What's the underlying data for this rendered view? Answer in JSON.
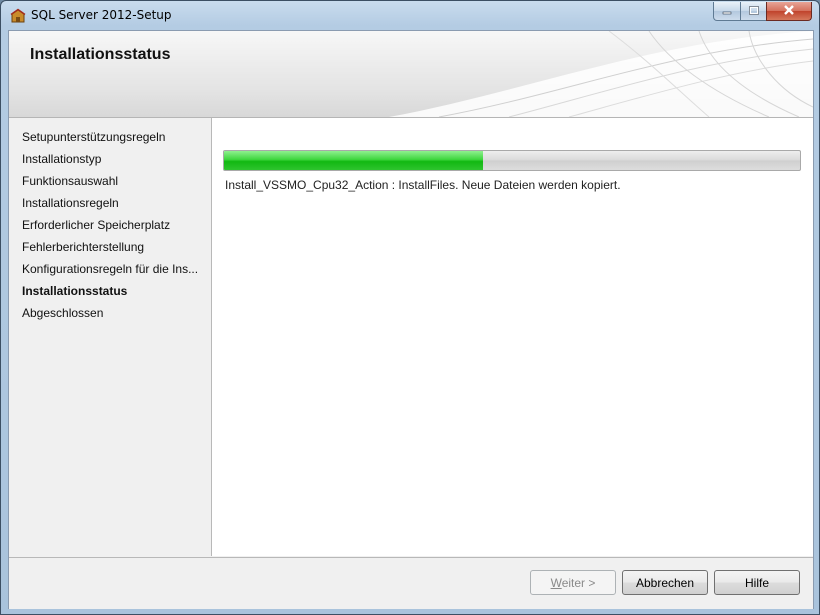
{
  "window": {
    "title": "SQL Server 2012-Setup"
  },
  "header": {
    "title": "Installationsstatus"
  },
  "sidebar": {
    "items": [
      {
        "label": "Setupunterstützungsregeln",
        "active": false
      },
      {
        "label": "Installationstyp",
        "active": false
      },
      {
        "label": "Funktionsauswahl",
        "active": false
      },
      {
        "label": "Installationsregeln",
        "active": false
      },
      {
        "label": "Erforderlicher Speicherplatz",
        "active": false
      },
      {
        "label": "Fehlerberichterstellung",
        "active": false
      },
      {
        "label": "Konfigurationsregeln für die Ins...",
        "active": false
      },
      {
        "label": "Installationsstatus",
        "active": true
      },
      {
        "label": "Abgeschlossen",
        "active": false
      }
    ]
  },
  "main": {
    "progress_fraction": 0.45,
    "status_text": "Install_VSSMO_Cpu32_Action : InstallFiles. Neue Dateien werden kopiert."
  },
  "footer": {
    "next_label": "Weiter >",
    "cancel_label": "Abbrechen",
    "help_label": "Hilfe"
  },
  "icons": {
    "app": "sql-setup-icon",
    "minimize": "minimize-icon",
    "maximize": "maximize-icon",
    "close": "close-icon"
  },
  "colors": {
    "progress_fill": "#2ec42e",
    "close_button": "#c0432c"
  }
}
